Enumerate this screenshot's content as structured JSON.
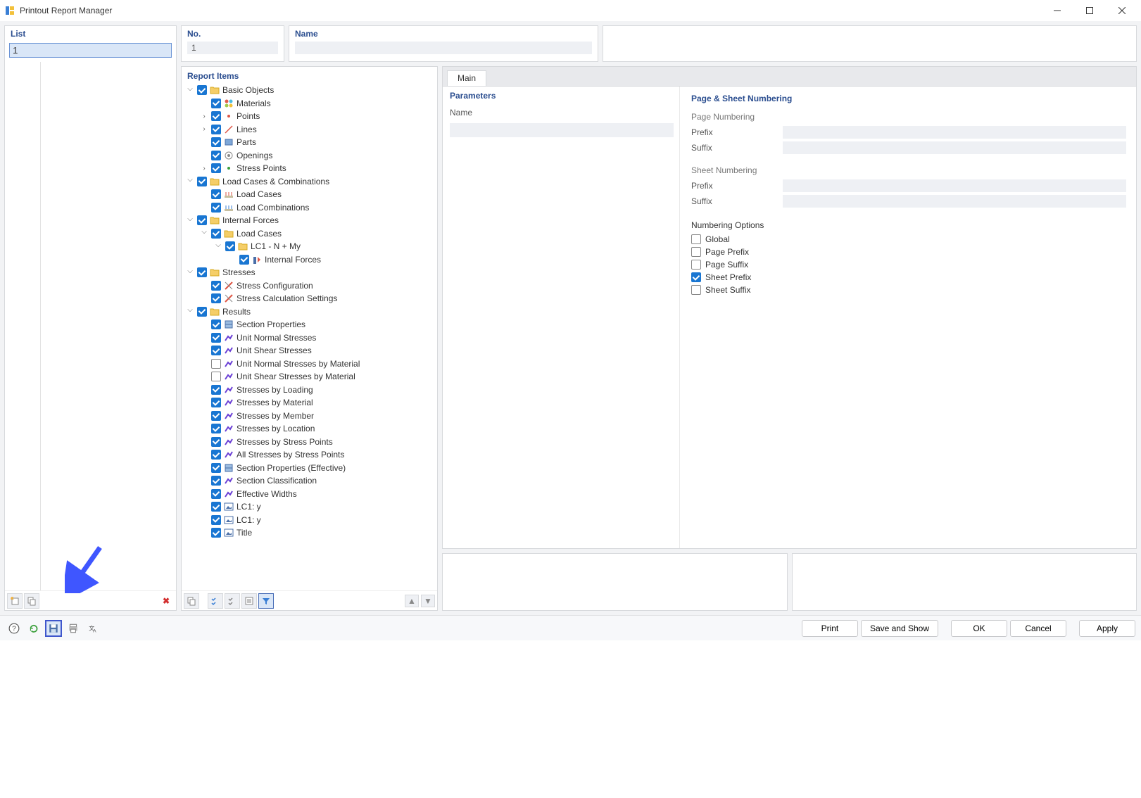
{
  "window": {
    "title": "Printout Report Manager"
  },
  "left": {
    "header": "List",
    "value": "1"
  },
  "strip": {
    "no_label": "No.",
    "no_value": "1",
    "name_label": "Name",
    "name_value": ""
  },
  "mid": {
    "header": "Report Items"
  },
  "tree": [
    {
      "indent": 0,
      "exp": "v",
      "chk": true,
      "icon": "folder",
      "label": "Basic Objects"
    },
    {
      "indent": 1,
      "exp": "",
      "chk": true,
      "icon": "materials",
      "label": "Materials"
    },
    {
      "indent": 1,
      "exp": ">",
      "chk": true,
      "icon": "point",
      "label": "Points"
    },
    {
      "indent": 1,
      "exp": ">",
      "chk": true,
      "icon": "line",
      "label": "Lines"
    },
    {
      "indent": 1,
      "exp": "",
      "chk": true,
      "icon": "part",
      "label": "Parts"
    },
    {
      "indent": 1,
      "exp": "",
      "chk": true,
      "icon": "opening",
      "label": "Openings"
    },
    {
      "indent": 1,
      "exp": ">",
      "chk": true,
      "icon": "spoint",
      "label": "Stress Points"
    },
    {
      "indent": 0,
      "exp": "v",
      "chk": true,
      "icon": "folder",
      "label": "Load Cases & Combinations"
    },
    {
      "indent": 1,
      "exp": "",
      "chk": true,
      "icon": "loadcase",
      "label": "Load Cases"
    },
    {
      "indent": 1,
      "exp": "",
      "chk": true,
      "icon": "loadcomb",
      "label": "Load Combinations"
    },
    {
      "indent": 0,
      "exp": "v",
      "chk": true,
      "icon": "folder",
      "label": "Internal Forces"
    },
    {
      "indent": 1,
      "exp": "v",
      "chk": true,
      "icon": "folder",
      "label": "Load Cases"
    },
    {
      "indent": 2,
      "exp": "v",
      "chk": true,
      "icon": "folder",
      "label": "LC1 - N + My"
    },
    {
      "indent": 3,
      "exp": "",
      "chk": true,
      "icon": "iforce",
      "label": "Internal Forces"
    },
    {
      "indent": 0,
      "exp": "v",
      "chk": true,
      "icon": "folder",
      "label": "Stresses"
    },
    {
      "indent": 1,
      "exp": "",
      "chk": true,
      "icon": "sconf",
      "label": "Stress Configuration"
    },
    {
      "indent": 1,
      "exp": "",
      "chk": true,
      "icon": "sconf",
      "label": "Stress Calculation Settings"
    },
    {
      "indent": 0,
      "exp": "v",
      "chk": true,
      "icon": "folder",
      "label": "Results"
    },
    {
      "indent": 1,
      "exp": "",
      "chk": true,
      "icon": "secprop",
      "label": "Section Properties"
    },
    {
      "indent": 1,
      "exp": "",
      "chk": true,
      "icon": "stress",
      "label": "Unit Normal Stresses"
    },
    {
      "indent": 1,
      "exp": "",
      "chk": true,
      "icon": "stress",
      "label": "Unit Shear Stresses"
    },
    {
      "indent": 1,
      "exp": "",
      "chk": false,
      "icon": "stress",
      "label": "Unit Normal Stresses by Material"
    },
    {
      "indent": 1,
      "exp": "",
      "chk": false,
      "icon": "stress",
      "label": "Unit Shear Stresses by Material"
    },
    {
      "indent": 1,
      "exp": "",
      "chk": true,
      "icon": "stress",
      "label": "Stresses by Loading"
    },
    {
      "indent": 1,
      "exp": "",
      "chk": true,
      "icon": "stress",
      "label": "Stresses by Material"
    },
    {
      "indent": 1,
      "exp": "",
      "chk": true,
      "icon": "stress",
      "label": "Stresses by Member"
    },
    {
      "indent": 1,
      "exp": "",
      "chk": true,
      "icon": "stress",
      "label": "Stresses by Location"
    },
    {
      "indent": 1,
      "exp": "",
      "chk": true,
      "icon": "stress",
      "label": "Stresses by Stress Points"
    },
    {
      "indent": 1,
      "exp": "",
      "chk": true,
      "icon": "stress",
      "label": "All Stresses by Stress Points"
    },
    {
      "indent": 1,
      "exp": "",
      "chk": true,
      "icon": "secprop",
      "label": "Section Properties (Effective)"
    },
    {
      "indent": 1,
      "exp": "",
      "chk": true,
      "icon": "stress",
      "label": "Section Classification"
    },
    {
      "indent": 1,
      "exp": "",
      "chk": true,
      "icon": "stress",
      "label": "Effective Widths"
    },
    {
      "indent": 1,
      "exp": "",
      "chk": true,
      "icon": "img",
      "label": "LC1: y"
    },
    {
      "indent": 1,
      "exp": "",
      "chk": true,
      "icon": "img",
      "label": "LC1: y"
    },
    {
      "indent": 1,
      "exp": "",
      "chk": true,
      "icon": "img",
      "label": "Title"
    }
  ],
  "tabs": {
    "main": "Main"
  },
  "params": {
    "header": "Parameters",
    "name_label": "Name",
    "name_value": ""
  },
  "numbering": {
    "header": "Page & Sheet Numbering",
    "page_h": "Page Numbering",
    "sheet_h": "Sheet Numbering",
    "prefix": "Prefix",
    "suffix": "Suffix",
    "opts_h": "Numbering Options",
    "opt_global": "Global",
    "opt_page_prefix": "Page Prefix",
    "opt_page_suffix": "Page Suffix",
    "opt_sheet_prefix": "Sheet Prefix",
    "opt_sheet_suffix": "Sheet Suffix",
    "chk": {
      "global": false,
      "page_prefix": false,
      "page_suffix": false,
      "sheet_prefix": true,
      "sheet_suffix": false
    }
  },
  "buttons": {
    "print": "Print",
    "save_show": "Save and Show",
    "ok": "OK",
    "cancel": "Cancel",
    "apply": "Apply"
  }
}
